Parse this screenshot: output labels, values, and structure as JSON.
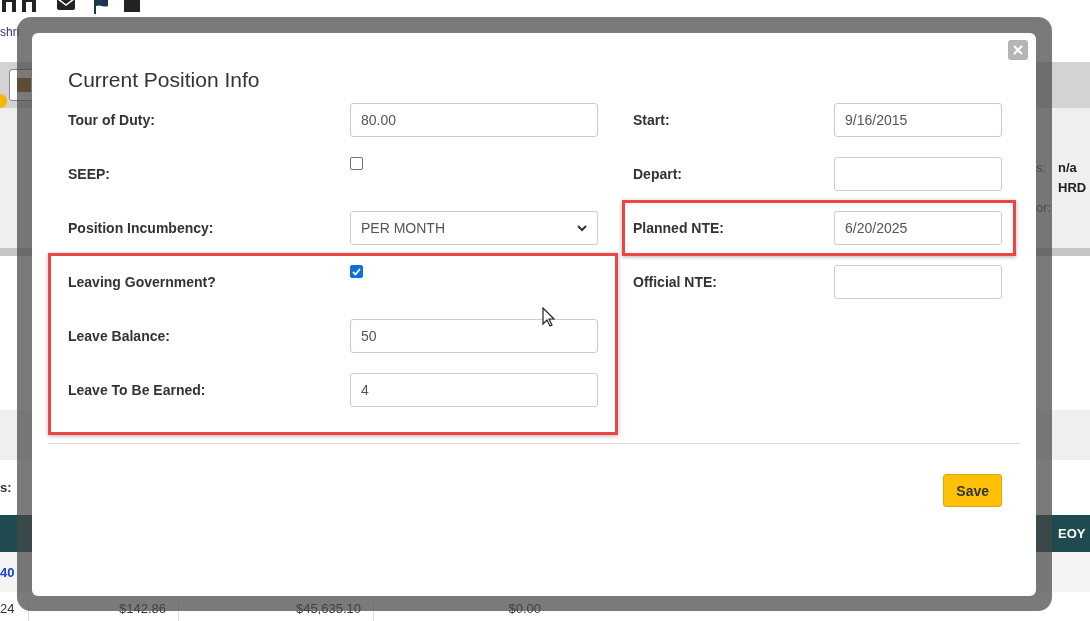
{
  "background": {
    "byline": "shri",
    "info_rows": [
      {
        "label": "s:",
        "value": "n/a"
      },
      {
        "value": "HRD"
      },
      {
        "label": "or:"
      }
    ],
    "summary_label": "s:",
    "table_header": "EOY",
    "link_cell": "40",
    "row_cells": [
      "24",
      "$142.86",
      "$45,635.10",
      "$0.00"
    ]
  },
  "dialog": {
    "title": "Current Position Info",
    "left_fields": [
      {
        "label": "Tour of Duty:",
        "kind": "text",
        "value": "80.00",
        "highlighted": false
      },
      {
        "label": "SEEP:",
        "kind": "checkbox",
        "checked": false,
        "highlighted": false
      },
      {
        "label": "Position Incumbency:",
        "kind": "select",
        "value": "PER MONTH",
        "highlighted": false
      },
      {
        "label": "Leaving Government?",
        "kind": "checkbox",
        "checked": true,
        "highlighted": true
      },
      {
        "label": "Leave Balance:",
        "kind": "text",
        "value": "50",
        "highlighted": true
      },
      {
        "label": "Leave To Be Earned:",
        "kind": "text",
        "value": "4",
        "highlighted": true
      }
    ],
    "right_fields": [
      {
        "label": "Start:",
        "kind": "text",
        "value": "9/16/2015",
        "highlighted": false
      },
      {
        "label": "Depart:",
        "kind": "text",
        "highlighted": false
      },
      {
        "label": "Planned NTE:",
        "kind": "text",
        "value": "6/20/2025",
        "highlighted": true
      },
      {
        "label": "Official NTE:",
        "kind": "text",
        "highlighted": false
      }
    ],
    "save_button": "Save"
  }
}
